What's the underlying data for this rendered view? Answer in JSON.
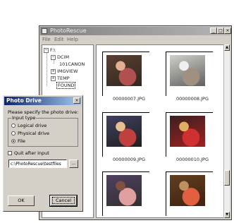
{
  "main_window": {
    "title": "PhotoRescue",
    "menu": [
      "File",
      "Edit",
      "Help"
    ],
    "controls": {
      "minimize": "_",
      "maximize": "□",
      "close": "×"
    }
  },
  "tree": {
    "root": "F:\\",
    "items": [
      "DCIM",
      "101CANON",
      "IMGVIEW",
      "TEMP",
      "FOUND"
    ],
    "selected": "FOUND"
  },
  "thumbnails": [
    {
      "caption": "00000007.JPG",
      "palette": [
        "#5a4030",
        "#b05050",
        "#e0b090",
        "#302820"
      ]
    },
    {
      "caption": "00000008.JPG",
      "palette": [
        "#d0d0c8",
        "#a09080",
        "#f0f0f0",
        "#606060"
      ]
    },
    {
      "caption": "00000009.JPG",
      "palette": [
        "#404060",
        "#c04040",
        "#e8c090",
        "#202020"
      ]
    },
    {
      "caption": "00000010.JPG",
      "palette": [
        "#3a2020",
        "#d03030",
        "#e0b060",
        "#a02020"
      ]
    },
    {
      "caption": "",
      "palette": [
        "#504060",
        "#e0a0a0",
        "#805040",
        "#303030"
      ]
    },
    {
      "caption": "",
      "palette": [
        "#604020",
        "#e06040",
        "#c09060",
        "#402010"
      ]
    }
  ],
  "dialog": {
    "title": "Photo Drive",
    "close": "×",
    "prompt": "Please specify the photo drive:",
    "group_label": "Input type",
    "options": [
      "Logical drive",
      "Physical drive",
      "File"
    ],
    "selected_option": "File",
    "checkbox_label": "Quit after input",
    "path_value": "c:\\PhotoRescue\\testfiles",
    "browse_label": "...",
    "ok_label": "OK",
    "cancel_label": "Cancel"
  }
}
